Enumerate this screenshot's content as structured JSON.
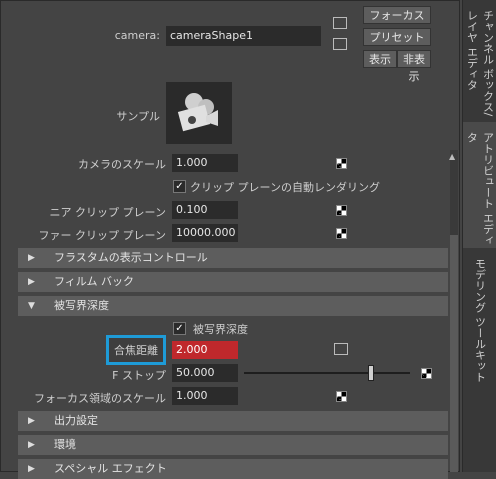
{
  "header": {
    "camera_label": "camera:",
    "camera_value": "cameraShape1",
    "focus_button": "フォーカス",
    "preset_button": "プリセット",
    "show_button": "表示",
    "hide_button": "非表示"
  },
  "sample": {
    "label": "サンプル"
  },
  "fields": {
    "camera_scale_label": "カメラのスケール",
    "camera_scale_value": "1.000",
    "auto_render_clip_label": "クリップ プレーンの自動レンダリング",
    "near_clip_label": "ニア クリップ プレーン",
    "near_clip_value": "0.100",
    "far_clip_label": "ファー クリップ プレーン",
    "far_clip_value": "10000.000"
  },
  "sections": {
    "frustum": "フラスタムの表示コントロール",
    "film_back": "フィルム バック",
    "dof": "被写界深度",
    "output": "出力設定",
    "environment": "環境",
    "special": "スペシャル エフェクト"
  },
  "dof": {
    "checkbox_label": "被写界深度",
    "focus_distance_label": "合焦距離",
    "focus_distance_value": "2.000",
    "fstop_label": "F ストップ",
    "fstop_value": "50.000",
    "focus_region_scale_label": "フォーカス領域のスケール",
    "focus_region_scale_value": "1.000"
  },
  "side_tabs": {
    "tab1": "チャンネル ボックス/レイヤ エディタ",
    "tab2": "アトリビュート エディタ",
    "tab3": "モデリング ツールキット"
  },
  "colors": {
    "highlight": "#1e9bd7",
    "focus_field": "#c0282c"
  }
}
